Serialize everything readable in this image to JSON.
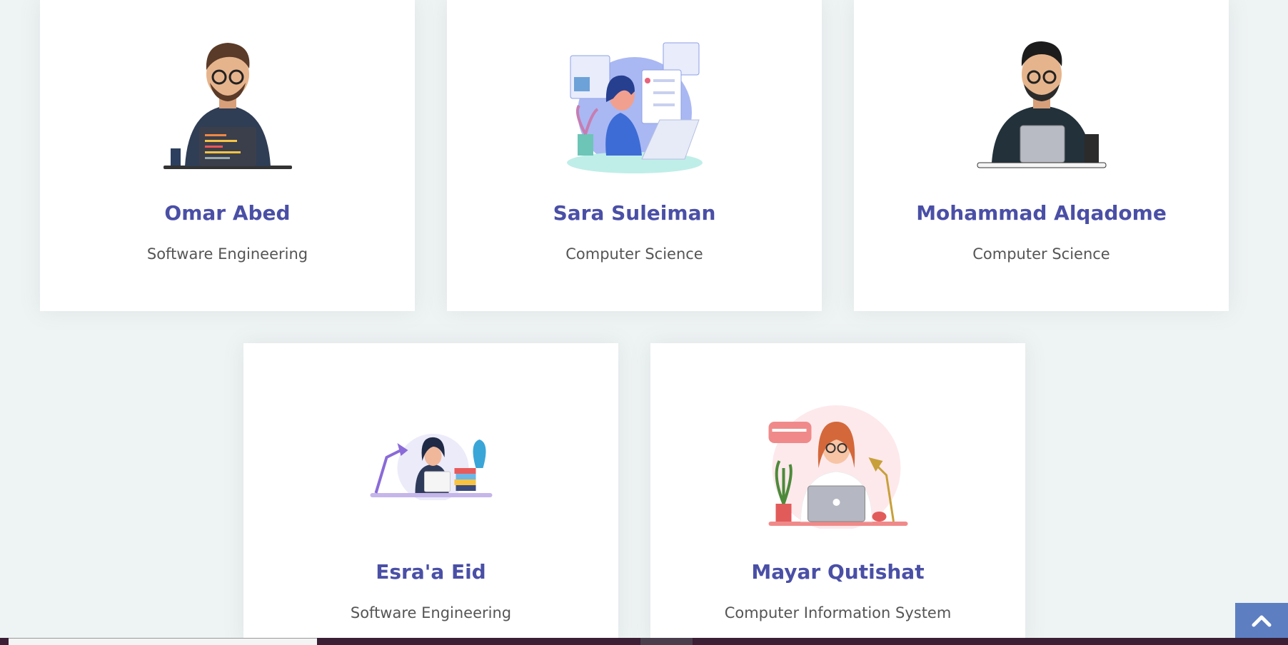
{
  "team": [
    {
      "name": "Omar Abed",
      "dept": "Software Engineering",
      "avatar": "developer-man-laptop-icon"
    },
    {
      "name": "Sara Suleiman",
      "dept": "Computer Science",
      "avatar": "woman-laptop-illustration-icon"
    },
    {
      "name": "Mohammad Alqadome",
      "dept": "Computer Science",
      "avatar": "bearded-man-laptop-icon"
    },
    {
      "name": "Esra'a Eid",
      "dept": "Software Engineering",
      "avatar": "woman-desk-books-icon"
    },
    {
      "name": "Mayar Qutishat",
      "dept": "Computer Information System",
      "avatar": "woman-laptop-plant-lamp-icon"
    }
  ],
  "colors": {
    "name": "#4a4fa6",
    "dept": "#555555",
    "background": "#eef3f3",
    "scroll_button": "#5d7fc2"
  },
  "scroll_top": {
    "icon": "chevron-up-icon"
  }
}
